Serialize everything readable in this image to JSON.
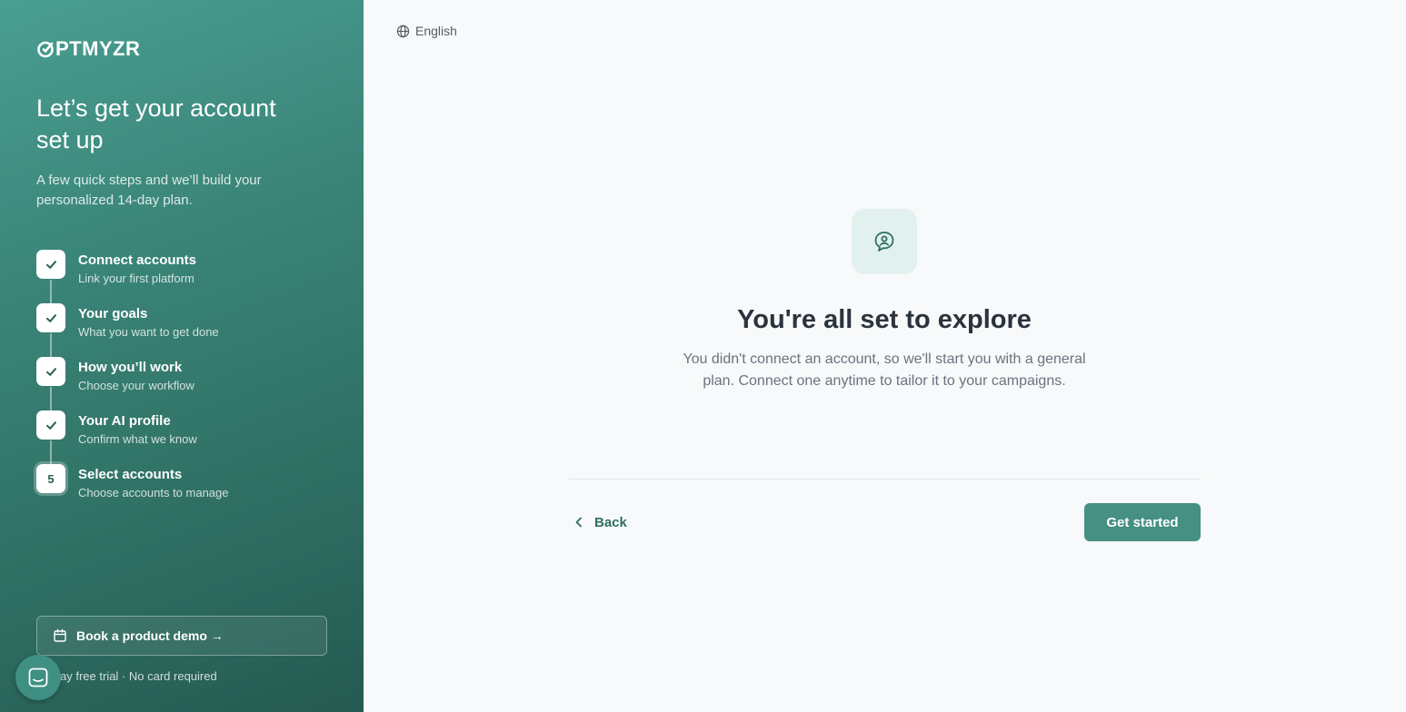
{
  "brand": {
    "logo_text": "PTMYZR",
    "logo_full": "OPTMYZR"
  },
  "sidebar": {
    "headline": "Let’s get your account set up",
    "subtext": "A few quick steps and we’ll build your personalized 14-day plan.",
    "steps": [
      {
        "title": "Connect accounts",
        "subtitle": "Link your first platform",
        "status": "done",
        "icon": "check-icon"
      },
      {
        "title": "Your goals",
        "subtitle": "What you want to get done",
        "status": "done",
        "icon": "check-icon"
      },
      {
        "title": "How you’ll work",
        "subtitle": "Choose your workflow",
        "status": "done",
        "icon": "check-icon"
      },
      {
        "title": "Your AI profile",
        "subtitle": "Confirm what we know",
        "status": "done",
        "icon": "check-icon"
      },
      {
        "title": "Select accounts",
        "subtitle": "Choose accounts to manage",
        "status": "current",
        "number": "5"
      }
    ],
    "demo_button": "Book a product demo →",
    "trial_text": "14-day free trial · No card required"
  },
  "header": {
    "language": "English",
    "language_icon": "globe-icon"
  },
  "main": {
    "icon": "chat-user-icon",
    "title": "You're all set to explore",
    "description": "You didn't connect an account, so we'll start you with a general plan. Connect one anytime to tailor it to your campaigns."
  },
  "footer": {
    "back_label": "Back",
    "primary_label": "Get started"
  },
  "colors": {
    "accent": "#458f83",
    "sidebar_top": "#4a9e92",
    "sidebar_bottom": "#245a51",
    "icon_bg": "#e3f1ee"
  }
}
